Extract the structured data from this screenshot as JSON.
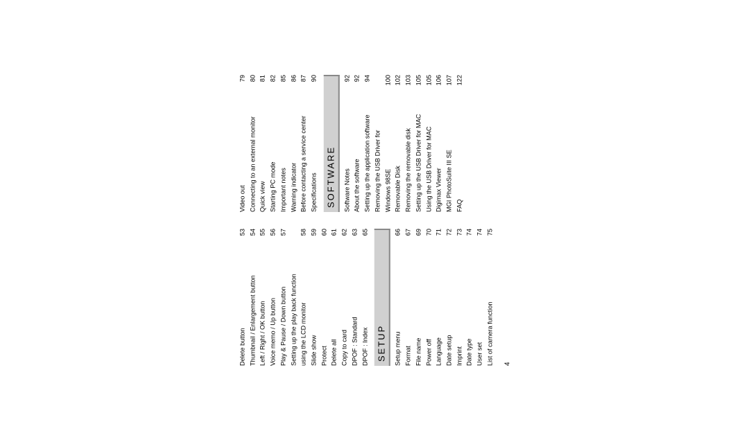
{
  "page_number": "4",
  "sections": {
    "setup": "SETUP",
    "software": "SOFTWARE"
  },
  "left_top": [
    {
      "label": "Delete button",
      "page": "53"
    },
    {
      "label": "Thumbnail / Enlargement button",
      "page": "54"
    },
    {
      "label": "Left / Right / OK button",
      "page": "55"
    },
    {
      "label": "Voice memo / Up button",
      "page": "56"
    },
    {
      "label": "Play & Pause / Down button",
      "page": "57"
    },
    {
      "label": "Setting up the play back function",
      "page": ""
    },
    {
      "label": "using the LCD monitor",
      "page": "58"
    },
    {
      "label": "Slide show",
      "page": "59"
    },
    {
      "label": "Protect",
      "page": "60"
    },
    {
      "label": "Delete all",
      "page": "61"
    },
    {
      "label": "Copy to card",
      "page": "62"
    },
    {
      "label": "DPOF : Standard",
      "page": "63"
    },
    {
      "label": "DPOF : Index",
      "page": "65"
    }
  ],
  "left_bottom": [
    {
      "label": "Setup menu",
      "page": "66"
    },
    {
      "label": "Format",
      "page": "67"
    },
    {
      "label": "File name",
      "page": "69"
    },
    {
      "label": "Power off",
      "page": "70"
    },
    {
      "label": "Language",
      "page": "71"
    },
    {
      "label": "Date setup",
      "page": "72"
    },
    {
      "label": "Imprint",
      "page": "73"
    },
    {
      "label": "Date type",
      "page": "74"
    },
    {
      "label": "User set",
      "page": "74"
    },
    {
      "label": "List of camera function",
      "page": "75"
    }
  ],
  "right_top": [
    {
      "label": "Video out",
      "page": "79"
    },
    {
      "label": "Connecting to an external monitor",
      "page": "80"
    },
    {
      "label": "Quick view",
      "page": "81"
    },
    {
      "label": "Starting PC mode",
      "page": "82"
    },
    {
      "label": "Important notes",
      "page": "85"
    },
    {
      "label": "Warning indicator",
      "page": "86"
    },
    {
      "label": "Before contacting a service center",
      "page": "87"
    },
    {
      "label": "Specifications",
      "page": "90"
    }
  ],
  "right_bottom": [
    {
      "label": "Software Notes",
      "page": "92"
    },
    {
      "label": "About the software",
      "page": "92"
    },
    {
      "label": "Setting up the application software",
      "page": "94"
    },
    {
      "label": "Removing the USB Driver for",
      "page": ""
    },
    {
      "label": "Windows 98SE",
      "page": "100"
    },
    {
      "label": "Removable Disk",
      "page": "102"
    },
    {
      "label": "Removing the removable disk",
      "page": "103"
    },
    {
      "label": "Setting up the USB Driver for MAC",
      "page": "105"
    },
    {
      "label": "Using the USB Driver for MAC",
      "page": "105"
    },
    {
      "label": "Digimax Viewer",
      "page": "106"
    },
    {
      "label": "MGI PhotoSuite III SE",
      "page": "107"
    },
    {
      "label": "FAQ",
      "page": "122"
    }
  ]
}
